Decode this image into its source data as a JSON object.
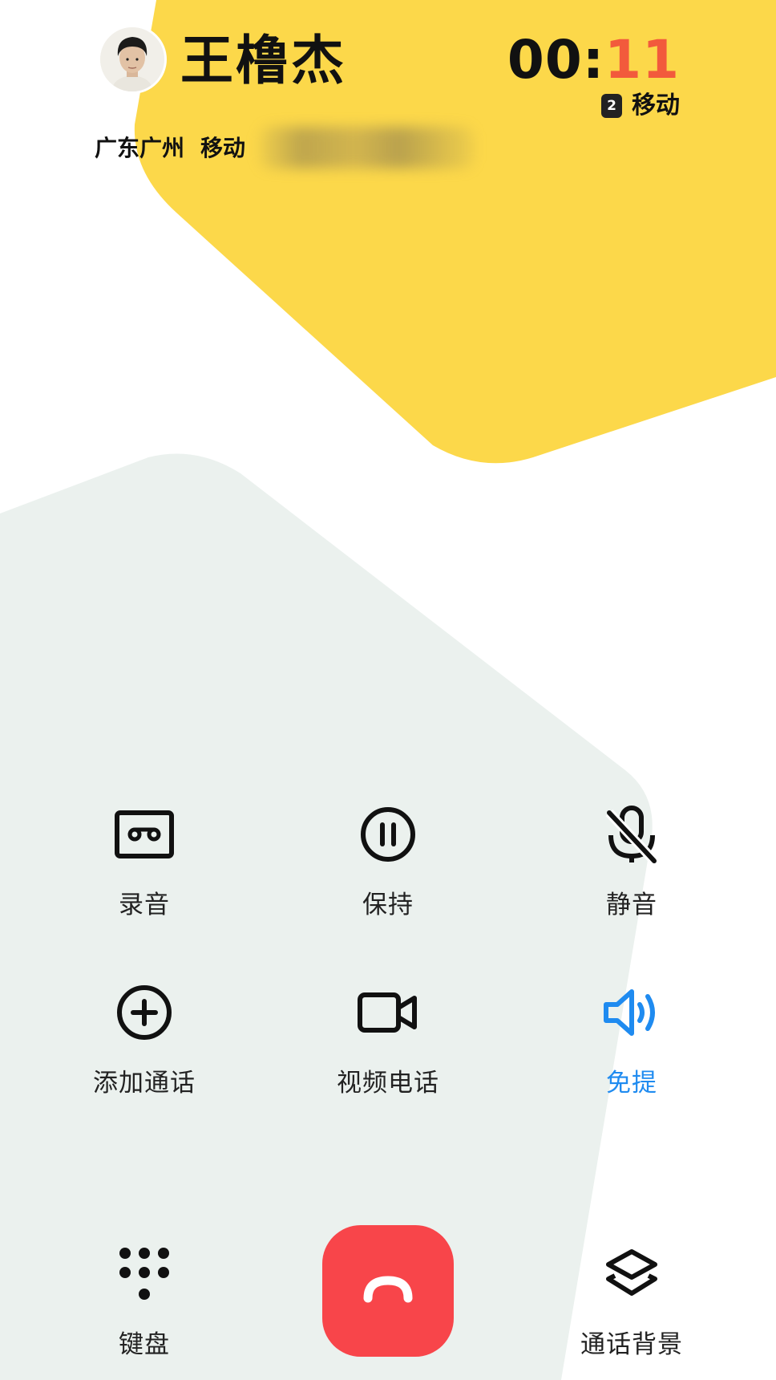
{
  "call": {
    "contact_name": "王橹杰",
    "location": "广东广州",
    "carrier": "移动",
    "timer_minutes": "00:",
    "timer_seconds": "11",
    "sim_slot": "2",
    "sim_carrier": "移动"
  },
  "controls": {
    "row1": [
      {
        "label": "录音",
        "icon": "cassette-record-icon"
      },
      {
        "label": "保持",
        "icon": "pause-hold-icon"
      },
      {
        "label": "静音",
        "icon": "mic-off-icon"
      }
    ],
    "row2": [
      {
        "label": "添加通话",
        "icon": "add-call-icon"
      },
      {
        "label": "视频电话",
        "icon": "video-camera-icon"
      },
      {
        "label": "免提",
        "icon": "speaker-icon",
        "active": true
      }
    ],
    "bottom": [
      {
        "label": "键盘",
        "icon": "dialpad-icon"
      },
      {
        "label": "",
        "icon": "hang-up-icon"
      },
      {
        "label": "通话背景",
        "icon": "layers-icon"
      }
    ]
  },
  "colors": {
    "accent_yellow": "#fcd84a",
    "bg_green_gray": "#ebf1ee",
    "end_call_red": "#f8454a",
    "active_blue": "#1f8bf0",
    "timer_seconds_red": "#f25a3c"
  }
}
